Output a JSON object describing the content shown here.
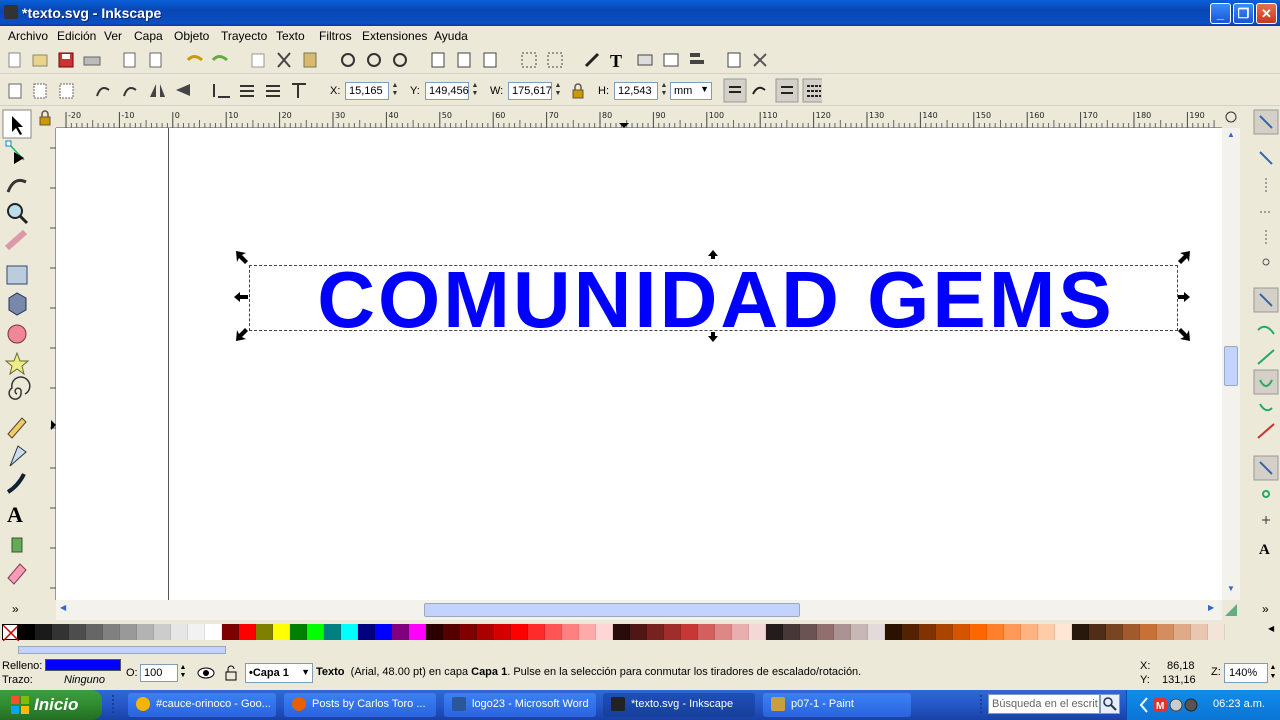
{
  "window": {
    "title": "*texto.svg - Inkscape",
    "minimize": "_",
    "maximize": "❐",
    "close": "✕"
  },
  "menu": [
    "Archivo",
    "Edición",
    "Ver",
    "Capa",
    "Objeto",
    "Trayecto",
    "Texto",
    "Filtros",
    "Extensiones",
    "Ayuda"
  ],
  "selector": {
    "x_label": "X:",
    "x": "15,165",
    "y_label": "Y:",
    "y": "149,456",
    "w_label": "W:",
    "w": "175,617",
    "h_label": "H:",
    "h": "12,543",
    "unit": "mm"
  },
  "ruler": {
    "ticks": [
      "-20",
      "-10",
      "0",
      "10",
      "20",
      "30",
      "40",
      "50",
      "60",
      "70",
      "80",
      "90",
      "100",
      "110",
      "120",
      "130",
      "140",
      "150",
      "160",
      "170",
      "180",
      "190"
    ]
  },
  "canvas": {
    "text": "COMUNIDAD GEMS",
    "text_color": "#0000ff"
  },
  "status": {
    "fill_label": "Relleno:",
    "fill_color": "#0000ff",
    "stroke_label": "Trazo:",
    "stroke_value": "Ninguno",
    "opacity_label": "O:",
    "opacity": "100",
    "layer": "•Capa 1",
    "message_bold": "Texto",
    "message_1": "(Arial, 48.00 pt) en capa",
    "message_layer": "Capa 1",
    "message_2": ". Pulse en la selección para conmutar los tiradores de escalado/rotación.",
    "cursor_x_label": "X:",
    "cursor_x": "86,18",
    "cursor_y_label": "Y:",
    "cursor_y": "131,16",
    "zoom_label": "Z:",
    "zoom": "140%"
  },
  "palette": [
    "#000000",
    "#1a1a1a",
    "#333333",
    "#4d4d4d",
    "#666666",
    "#808080",
    "#999999",
    "#b3b3b3",
    "#cccccc",
    "#e6e6e6",
    "#f2f2f2",
    "#ffffff",
    "#800000",
    "#ff0000",
    "#808000",
    "#ffff00",
    "#008000",
    "#00ff00",
    "#008080",
    "#00ffff",
    "#000080",
    "#0000ff",
    "#800080",
    "#ff00ff",
    "#2b0000",
    "#550000",
    "#800000",
    "#aa0000",
    "#d40000",
    "#ff0000",
    "#ff2a2a",
    "#ff5555",
    "#ff8080",
    "#ffaaaa",
    "#ffd5d5",
    "#280b0b",
    "#501616",
    "#782121",
    "#a02c2c",
    "#c83737",
    "#d35f5f",
    "#de8787",
    "#e9afaf",
    "#f4d7d7",
    "#241c1c",
    "#483737",
    "#6c5353",
    "#916f6f",
    "#ac9393",
    "#c8b7b7",
    "#e3dbdb",
    "#2b1100",
    "#552200",
    "#803300",
    "#aa4400",
    "#d45500",
    "#ff6600",
    "#ff7f2a",
    "#ff9955",
    "#ffb380",
    "#ffccaa",
    "#ffe6d5",
    "#28170b",
    "#502d16",
    "#784421",
    "#a05a2c",
    "#c87137",
    "#d38d5f",
    "#deaa87",
    "#e9c6af",
    "#f4e3d7"
  ],
  "taskbar": {
    "start": "Inicio",
    "tasks": [
      {
        "label": "#cauce-orinoco - Goo...",
        "color": "#f4b400"
      },
      {
        "label": "Posts by Carlos Toro ...",
        "color": "#e66000"
      },
      {
        "label": "logo23 - Microsoft Word",
        "color": "#2b579a"
      },
      {
        "label": "*texto.svg - Inkscape",
        "color": "#222222"
      },
      {
        "label": "p07-1 - Paint",
        "color": "#c8a040"
      }
    ],
    "search_placeholder": "Búsqueda en el escrit",
    "clock": "06:23 a.m."
  }
}
